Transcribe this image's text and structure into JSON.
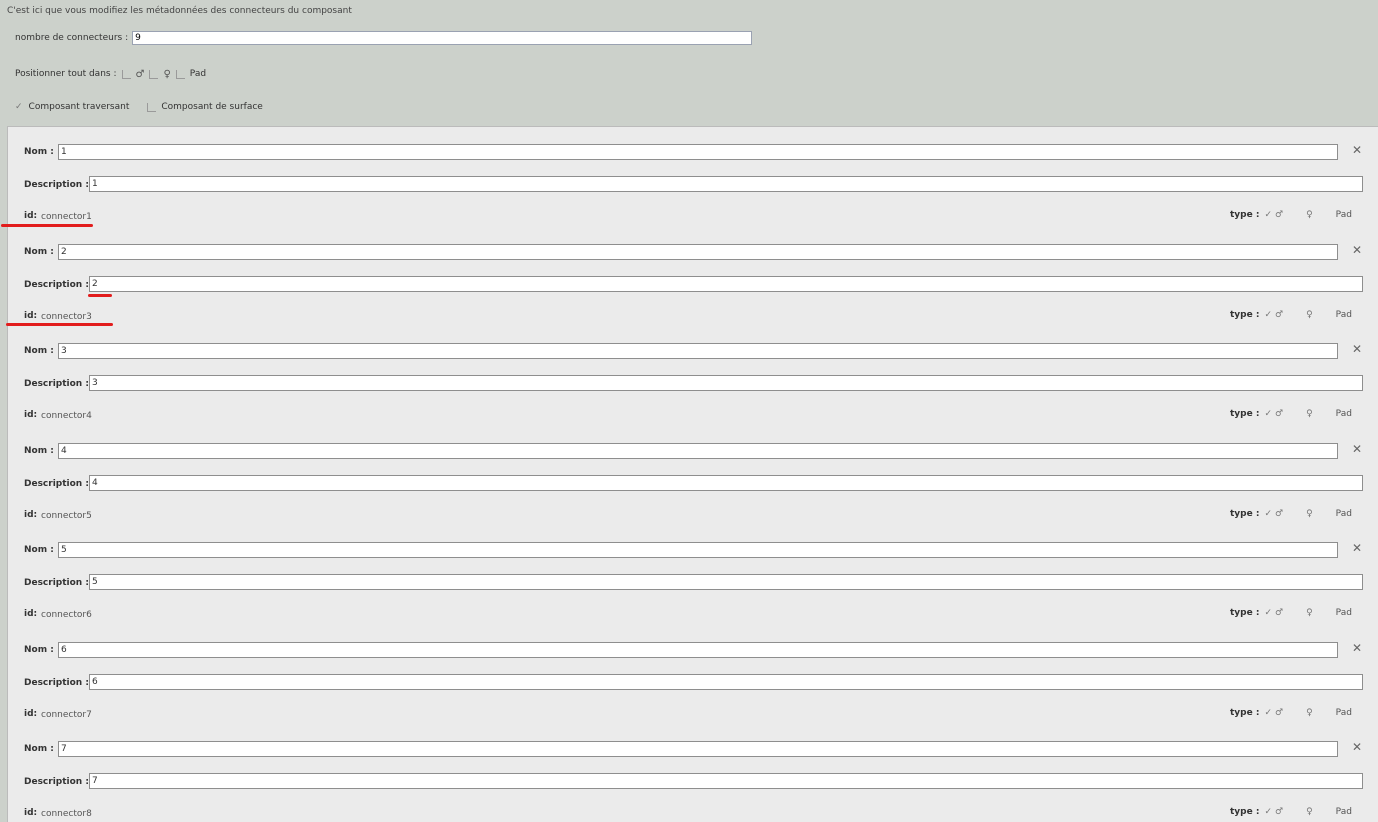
{
  "header": {
    "intro": "C'est ici que vous modifiez les métadonnées des connecteurs du composant",
    "count_label": "nombre de connecteurs :",
    "count_value": "9",
    "position_label": "Positionner tout dans :",
    "position_options": [
      "♂",
      "♀",
      "Pad"
    ],
    "through_hole_label": "Composant traversant",
    "through_hole_checked": true,
    "surface_label": "Composant de surface",
    "surface_checked": false
  },
  "labels": {
    "name": "Nom :",
    "description": "Description :",
    "id": "id:",
    "type": "type :",
    "male": "♂",
    "female": "♀",
    "pad": "Pad",
    "check": "✓",
    "close": "✕"
  },
  "connectors": [
    {
      "name": "1",
      "description": "1",
      "id": "connector1"
    },
    {
      "name": "2",
      "description": "2",
      "id": "connector3"
    },
    {
      "name": "3",
      "description": "3",
      "id": "connector4"
    },
    {
      "name": "4",
      "description": "4",
      "id": "connector5"
    },
    {
      "name": "5",
      "description": "5",
      "id": "connector6"
    },
    {
      "name": "6",
      "description": "6",
      "id": "connector7"
    },
    {
      "name": "7",
      "description": "7",
      "id": "connector8"
    }
  ],
  "annotation_color": "#e21c1c"
}
